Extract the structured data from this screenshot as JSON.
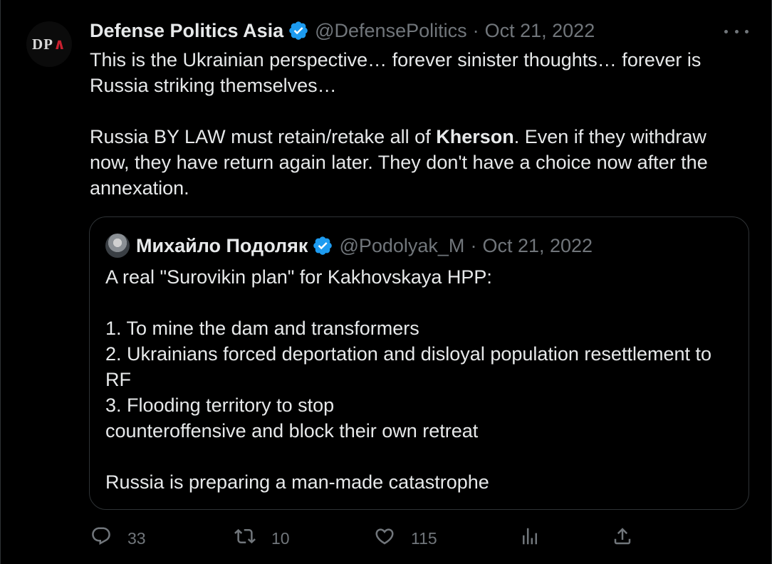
{
  "tweet": {
    "avatar_text": "DPA",
    "display_name": "Defense Politics Asia",
    "handle": "@DefensePolitics",
    "separator": "·",
    "date": "Oct 21, 2022",
    "text_p1": "This is the Ukrainian perspective… forever sinister thoughts… forever is Russia striking themselves…",
    "text_p2_before": "Russia BY LAW must retain/retake all of ",
    "text_p2_bold": "Kherson",
    "text_p2_after": ". Even if they withdraw now, they have return again later. They don't have a choice now after the annexation."
  },
  "quote": {
    "display_name": "Михайло Подоляк",
    "handle": "@Podolyak_M",
    "separator": "·",
    "date": "Oct 21, 2022",
    "line1": "A real \"Surovikin plan\" for Kakhovskaya HPP:",
    "item1": "1. To mine the dam and transformers",
    "item2": "2. Ukrainians forced deportation and disloyal population resettlement to RF",
    "item3_before": "3. Flooding territory to stop ",
    "item3_after": " counteroffensive and block their own retreat",
    "closing": "Russia is preparing a man-made catastrophe"
  },
  "actions": {
    "replies": "33",
    "retweets": "10",
    "likes": "115"
  },
  "icons": {
    "verified": "verified-badge-icon",
    "more": "more-dots-icon",
    "reply": "reply-icon",
    "retweet": "retweet-icon",
    "like": "heart-icon",
    "views": "views-icon",
    "share": "share-icon",
    "flag": "ukraine-flag-emoji"
  },
  "colors": {
    "background": "#000000",
    "text": "#e7e9ea",
    "muted": "#71767b",
    "verified": "#1d9bf0",
    "border": "#2f3336"
  }
}
